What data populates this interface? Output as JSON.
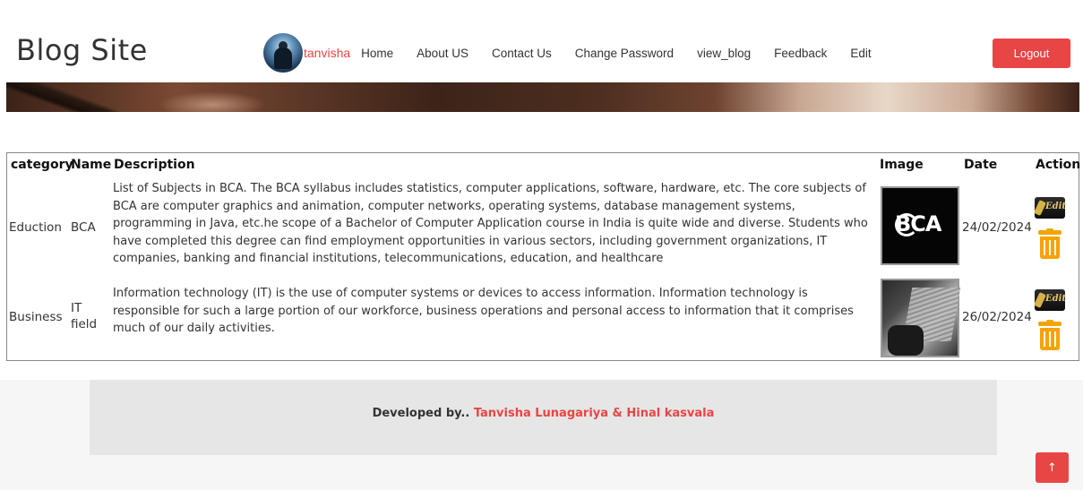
{
  "header": {
    "brand": "Blog Site",
    "username": "tanvisha",
    "nav": [
      "Home",
      "About US",
      "Contact Us",
      "Change Password",
      "view_blog",
      "Feedback",
      "Edit"
    ],
    "logout_label": "Logout"
  },
  "table": {
    "columns": [
      "category",
      "Name",
      "Description",
      "Image",
      "Date",
      "Action"
    ],
    "rows": [
      {
        "category": "Eduction",
        "name": "BCA",
        "description": "List of Subjects in BCA. The BCA syllabus includes statistics, computer applications, software, hardware, etc. The core subjects of BCA are computer graphics and animation, computer networks, operating systems, database management systems, programming in Java, etc.he scope of a Bachelor of Computer Application course in India is quite wide and diverse. Students who have completed this degree can find employment opportunities in various sectors, including government organizations, IT companies, banking and financial institutions, telecommunications, education, and healthcare",
        "image_label": "BCA",
        "date": "24/02/2024"
      },
      {
        "category": "Business",
        "name": "IT field",
        "description": "Information technology (IT) is the use of computer systems or devices to access information. Information technology is responsible for such a large portion of our workforce, business operations and personal access to information that it comprises much of our daily activities.",
        "date": "26/02/2024"
      }
    ],
    "edit_icon_text": "Edit"
  },
  "footer": {
    "prefix": "Developed by..",
    "names": "Tanvisha Lunagariya & Hinal kasvala"
  },
  "back_to_top_glyph": "↑",
  "colors": {
    "accent": "#e84545",
    "trash": "#f5a300"
  }
}
